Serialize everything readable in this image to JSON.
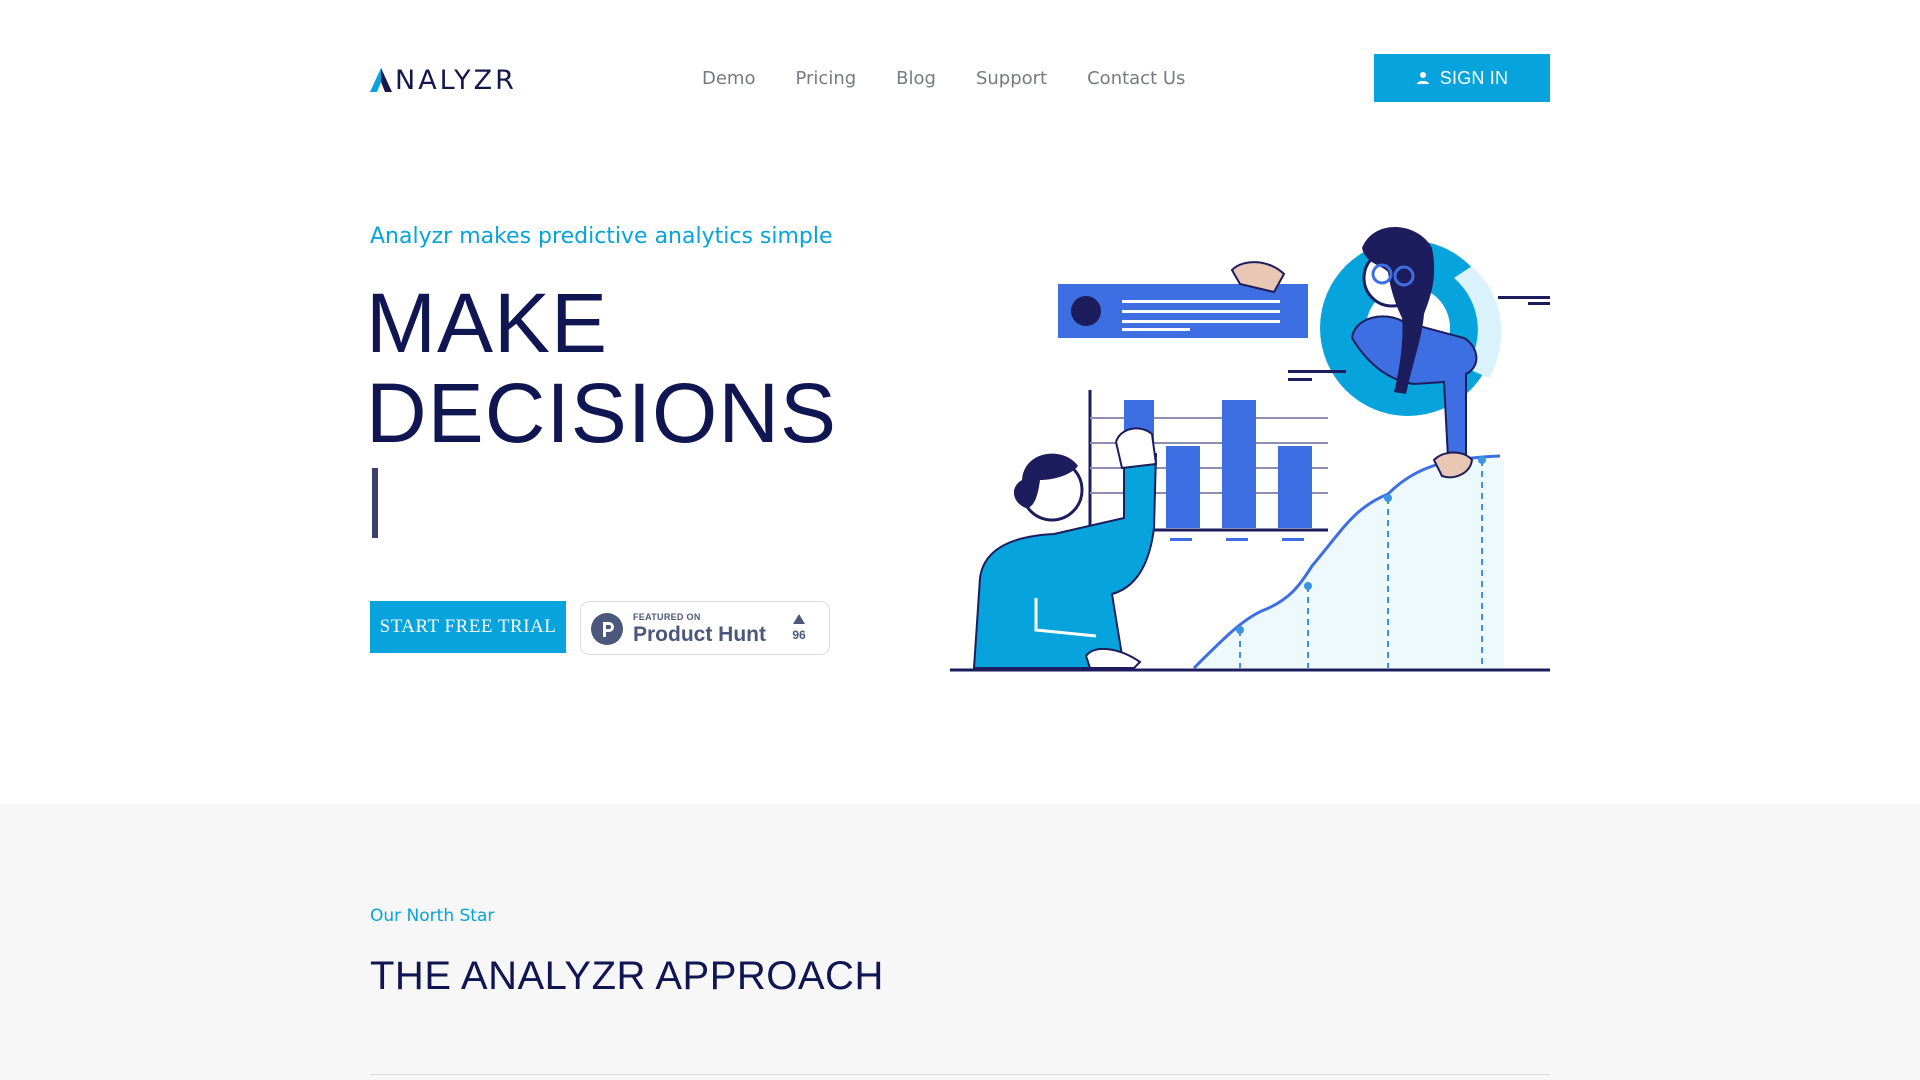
{
  "brand": {
    "name": "NALYZR",
    "accent": "#06a3dc",
    "navy": "#101652"
  },
  "nav": [
    {
      "label": "Demo"
    },
    {
      "label": "Pricing"
    },
    {
      "label": "Blog"
    },
    {
      "label": "Support"
    },
    {
      "label": "Contact Us"
    }
  ],
  "header": {
    "signin_label": "SIGN IN",
    "signin_icon": "user-icon"
  },
  "hero": {
    "tagline": "Analyzr makes predictive analytics simple",
    "headline_line1": "MAKE",
    "headline_line2": "DECISIONS",
    "cta_label": "START FREE TRIAL",
    "product_hunt": {
      "featured": "FEATURED ON",
      "name": "Product Hunt",
      "votes": "96"
    }
  },
  "section2": {
    "eyebrow": "Our North Star",
    "title": "THE ANALYZR APPROACH"
  }
}
